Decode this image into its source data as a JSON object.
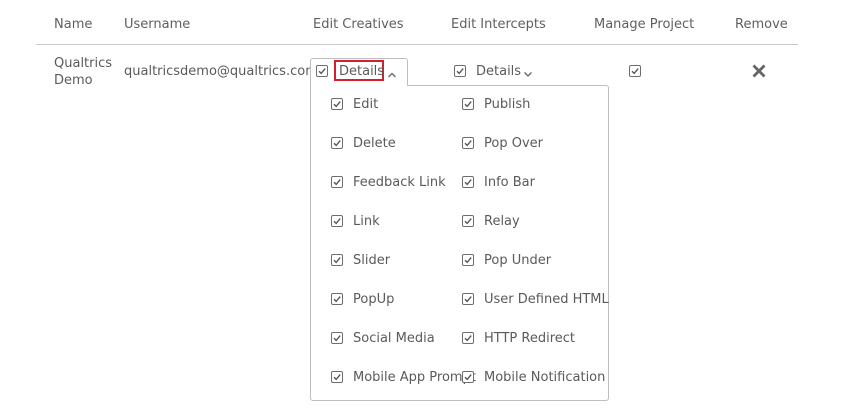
{
  "table": {
    "headers": {
      "name": "Name",
      "username": "Username",
      "edit_creatives": "Edit Creatives",
      "edit_intercepts": "Edit Intercepts",
      "manage_project": "Manage Project",
      "remove": "Remove"
    },
    "row": {
      "name_line1": "Qualtrics",
      "name_line2": "Demo",
      "username": "qualtricsdemo@qualtrics.com",
      "creatives_label": "Details",
      "intercepts_label": "Details"
    }
  },
  "creatives_dropdown": {
    "left_options": [
      {
        "label": "Edit",
        "checked": true
      },
      {
        "label": "Delete",
        "checked": true
      },
      {
        "label": "Feedback Link",
        "checked": true
      },
      {
        "label": "Link",
        "checked": true
      },
      {
        "label": "Slider",
        "checked": true
      },
      {
        "label": "PopUp",
        "checked": true
      },
      {
        "label": "Social Media",
        "checked": true
      },
      {
        "label": "Mobile App Prompt",
        "checked": true
      }
    ],
    "right_options": [
      {
        "label": "Publish",
        "checked": true
      },
      {
        "label": "Pop Over",
        "checked": true
      },
      {
        "label": "Info Bar",
        "checked": true
      },
      {
        "label": "Relay",
        "checked": true
      },
      {
        "label": "Pop Under",
        "checked": true
      },
      {
        "label": "User Defined HTML",
        "checked": true
      },
      {
        "label": "HTTP Redirect",
        "checked": true
      },
      {
        "label": "Mobile Notification",
        "checked": true
      }
    ]
  },
  "icons": {
    "checkbox": "checkbox-checked-icon",
    "chevron_up": "chevron-up-icon",
    "chevron_down": "chevron-down-icon",
    "remove": "close-icon"
  },
  "colors": {
    "text": "#5a5a5a",
    "border": "#bdbdbd",
    "highlight": "#d4202d",
    "remove_icon": "#666666"
  }
}
